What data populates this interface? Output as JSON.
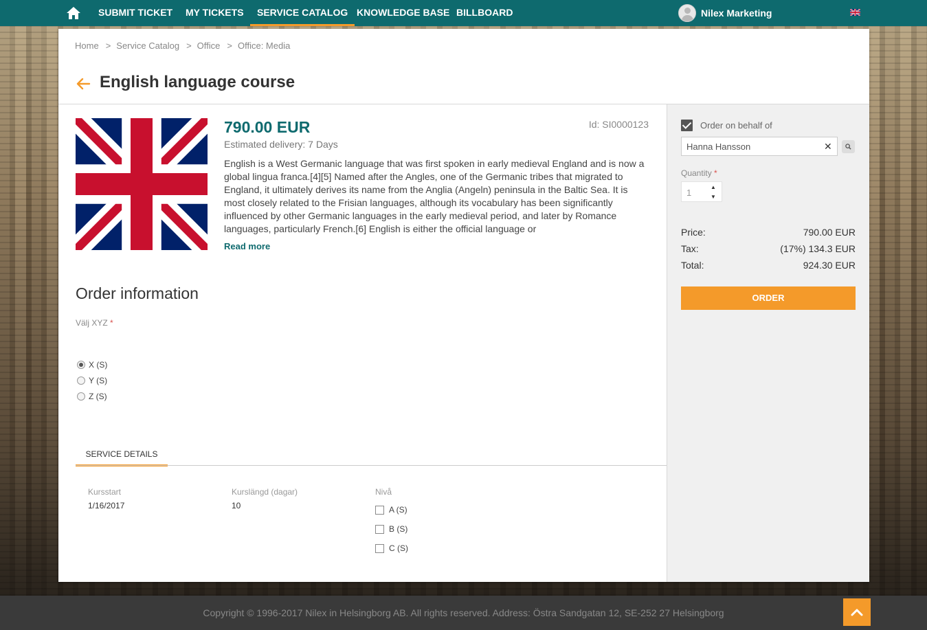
{
  "nav": {
    "items": [
      {
        "label": "SUBMIT TICKET"
      },
      {
        "label": "MY TICKETS"
      },
      {
        "label": "SERVICE CATALOG"
      },
      {
        "label": "KNOWLEDGE BASE"
      },
      {
        "label": "BILLBOARD"
      }
    ],
    "active": "SERVICE CATALOG",
    "user_name": "Nilex Marketing",
    "language_flag": "uk-flag-icon"
  },
  "breadcrumb": [
    "Home",
    "Service Catalog",
    "Office",
    "Office: Media"
  ],
  "page": {
    "title": "English language course",
    "price": "790.00 EUR",
    "delivery": "Estimated delivery: 7 Days",
    "id": "Id: SI0000123",
    "description": "English is a West Germanic language that was first spoken in early medieval England and is now a global lingua franca.[4][5] Named after the Angles, one of the Germanic tribes that migrated to England, it ultimately derives its name from the Anglia (Angeln) peninsula in the Baltic Sea. It is most closely related to the Frisian languages, although its vocabulary has been significantly influenced by other Germanic languages in the early medieval period, and later by Romance languages, particularly French.[6] English is either the official language or",
    "read_more": "Read more"
  },
  "order_info": {
    "title": "Order information",
    "field_label": "Välj XYZ",
    "required_mark": "*",
    "options": [
      {
        "label": "X (S)",
        "checked": true
      },
      {
        "label": "Y (S)",
        "checked": false
      },
      {
        "label": "Z (S)",
        "checked": false
      }
    ]
  },
  "service_details": {
    "tab_label": "SERVICE DETAILS",
    "kursstart_label": "Kursstart",
    "kursstart_value": "1/16/2017",
    "kurslangd_label": "Kurslängd (dagar)",
    "kurslangd_value": "10",
    "niva_label": "Nivå",
    "niva_options": [
      {
        "label": "A (S)",
        "checked": false
      },
      {
        "label": "B (S)",
        "checked": false
      },
      {
        "label": "C (S)",
        "checked": false
      }
    ]
  },
  "sidebar": {
    "behalf_label": "Order on behalf of",
    "behalf_checked": true,
    "person_value": "Hanna Hansson",
    "clear_glyph": "✕",
    "quantity_label": "Quantity",
    "quantity_value": "1",
    "price_label": "Price:",
    "price_value": "790.00 EUR",
    "tax_label": "Tax:",
    "tax_value": "(17%) 134.3 EUR",
    "total_label": "Total:",
    "total_value": "924.30 EUR",
    "order_button": "ORDER"
  },
  "footer": {
    "copyright": "Copyright © 1996-2017 Nilex in Helsingborg AB. All rights reserved. Address: Östra Sandgatan 12, SE-252 27 Helsingborg"
  },
  "colors": {
    "topbar": "#0e6a6e",
    "accent": "#f49a2a",
    "price": "#0e6a6e"
  }
}
